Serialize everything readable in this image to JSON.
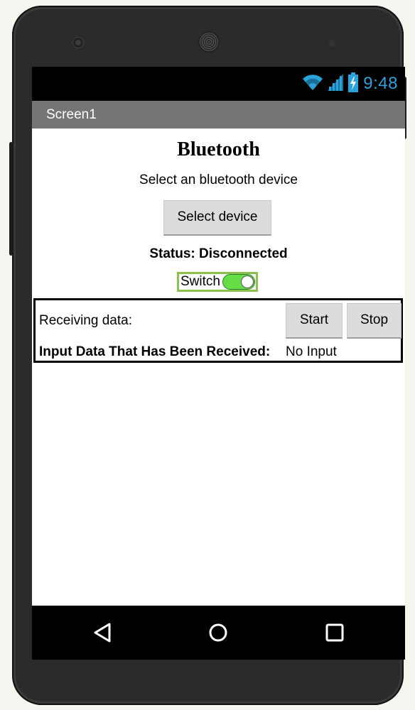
{
  "status_bar": {
    "time": "9:48",
    "icons": [
      "wifi-icon",
      "signal-icon",
      "battery-icon"
    ],
    "clock_color": "#2ba3d9"
  },
  "app_bar": {
    "title": "Screen1",
    "color": "#757575"
  },
  "main": {
    "heading": "Bluetooth",
    "subtitle": "Select an bluetooth device",
    "select_button_label": "Select device",
    "status_text": "Status: Disconnected",
    "switch": {
      "label": "Switch",
      "on": true,
      "accent": "#66dd44",
      "border_color": "#8bc34a"
    },
    "data_panel": {
      "receiving_label": "Receiving data:",
      "start_label": "Start",
      "stop_label": "Stop",
      "input_label": "Input Data That Has Been Received:",
      "input_value": "No Input"
    }
  },
  "nav_bar": {
    "buttons": [
      "back-icon",
      "home-icon",
      "recents-icon"
    ]
  }
}
